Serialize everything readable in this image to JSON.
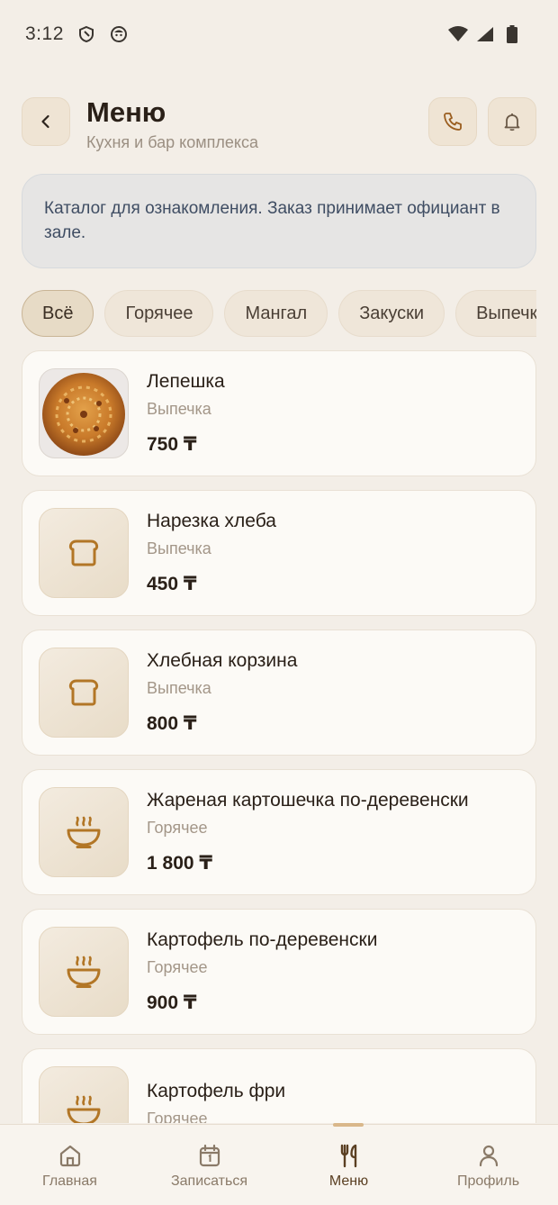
{
  "status_bar": {
    "time": "3:12"
  },
  "header": {
    "title": "Меню",
    "subtitle": "Кухня и бар комплекса"
  },
  "notice": {
    "text": "Каталог для ознакомления. Заказ принимает официант в зале."
  },
  "categories": [
    "Всё",
    "Горячее",
    "Мангал",
    "Закуски",
    "Выпечка"
  ],
  "active_category": "Всё",
  "items": [
    {
      "name": "Лепешка",
      "category": "Выпечка",
      "price": "750 ₸",
      "icon": "flatbread-photo"
    },
    {
      "name": "Нарезка хлеба",
      "category": "Выпечка",
      "price": "450 ₸",
      "icon": "bread-icon"
    },
    {
      "name": "Хлебная корзина",
      "category": "Выпечка",
      "price": "800 ₸",
      "icon": "bread-icon"
    },
    {
      "name": "Жареная картошечка по-деревенски",
      "category": "Горячее",
      "price": "1 800 ₸",
      "icon": "hot-bowl-icon"
    },
    {
      "name": "Картофель по-деревенски",
      "category": "Горячее",
      "price": "900 ₸",
      "icon": "hot-bowl-icon"
    },
    {
      "name": "Картофель фри",
      "category": "Горячее",
      "price": "",
      "icon": "hot-bowl-icon"
    }
  ],
  "bottom_nav": [
    {
      "label": "Главная",
      "icon": "home-icon"
    },
    {
      "label": "Записаться",
      "icon": "calendar-icon"
    },
    {
      "label": "Меню",
      "icon": "cutlery-icon"
    },
    {
      "label": "Профиль",
      "icon": "user-icon"
    }
  ],
  "colors": {
    "accent": "#9a5d1f",
    "background": "#f3eee7",
    "card": "#fcfaf6",
    "notice_text": "#3f4d63"
  }
}
